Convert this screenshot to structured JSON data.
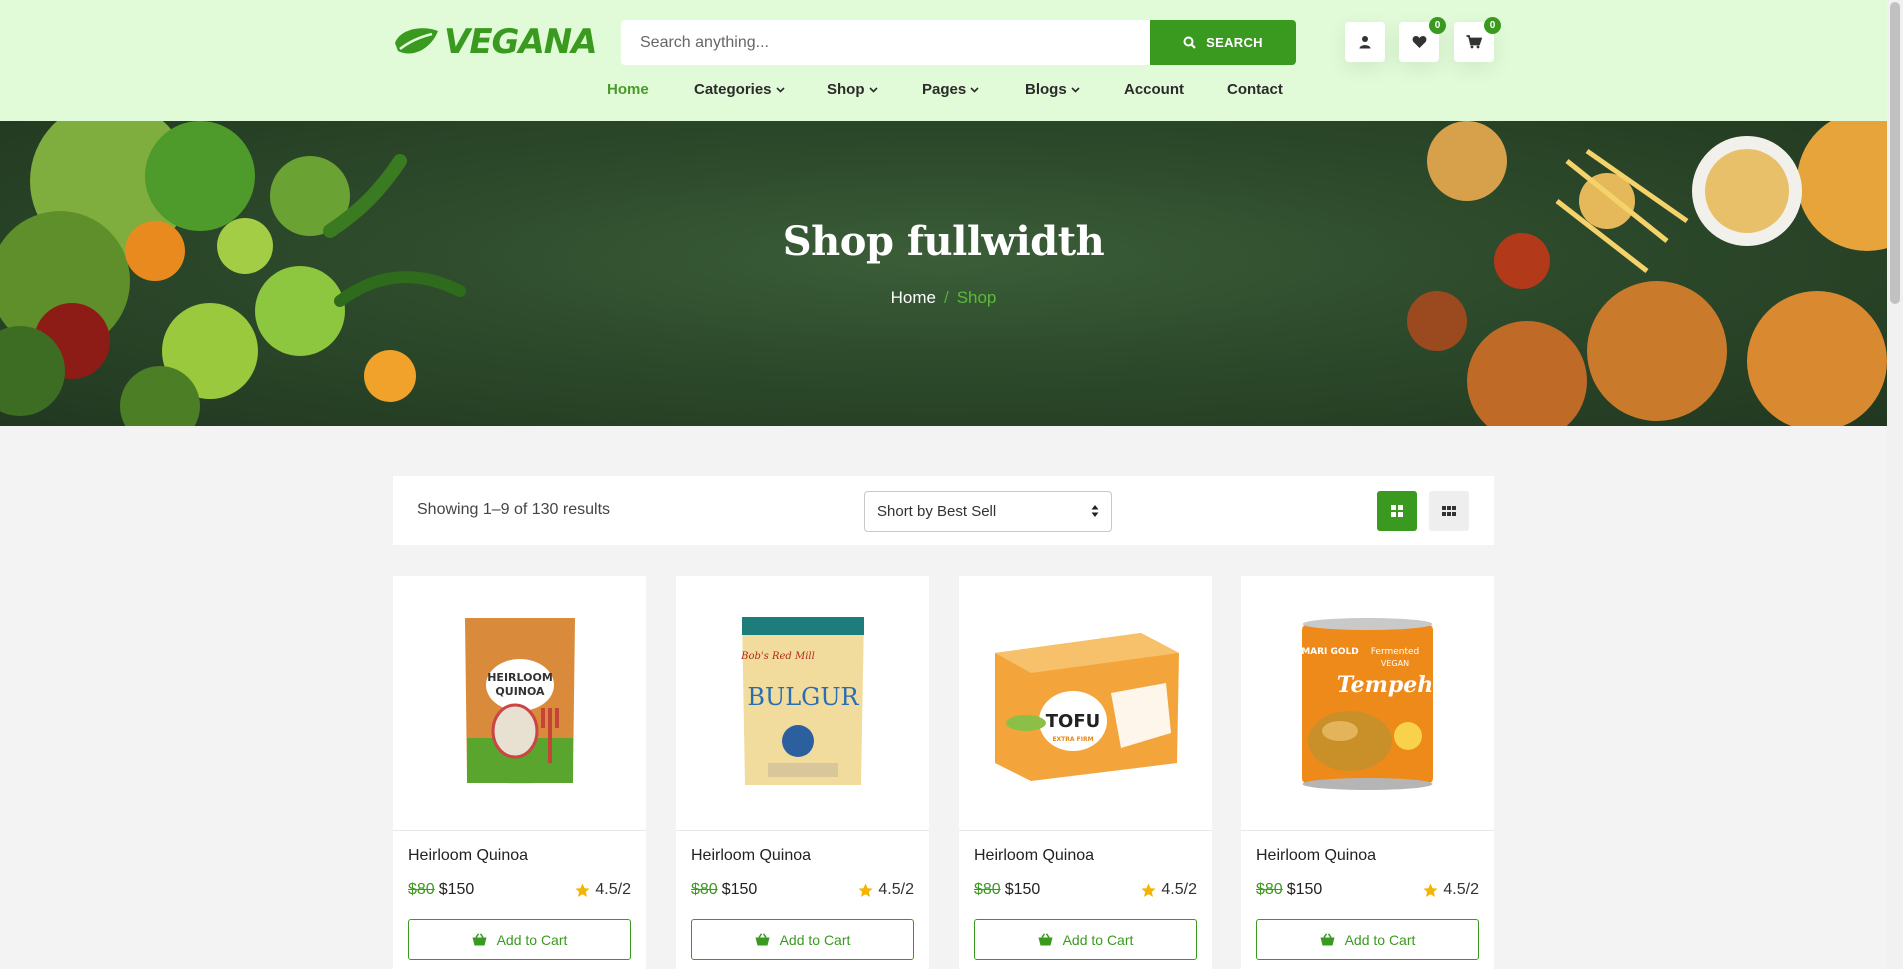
{
  "brand": {
    "name": "VEGANA",
    "accent": "#3a9a1f",
    "header_bg": "#e1fbd8"
  },
  "search": {
    "placeholder": "Search anything...",
    "button_label": "SEARCH"
  },
  "header_icons": {
    "wishlist_count": "0",
    "cart_count": "0"
  },
  "nav": {
    "items": [
      {
        "label": "Home",
        "active": true
      },
      {
        "label": "Categories",
        "dropdown": true
      },
      {
        "label": "Shop",
        "dropdown": true
      },
      {
        "label": "Pages",
        "dropdown": true
      },
      {
        "label": "Blogs",
        "dropdown": true
      },
      {
        "label": "Account"
      },
      {
        "label": "Contact"
      }
    ]
  },
  "banner": {
    "title": "Shop fullwidth",
    "breadcrumb": {
      "home": "Home",
      "separator": "/",
      "current": "Shop"
    }
  },
  "toolbar": {
    "result_count": "Showing 1–9 of 130 results",
    "sort_value": "Short by Best Sell"
  },
  "products": [
    {
      "name": "Heirloom Quinoa",
      "old_price": "$80",
      "price": "$150",
      "rating": "4.5/2",
      "cart_label": "Add to Cart",
      "image": "quinoa-bag"
    },
    {
      "name": "Heirloom Quinoa",
      "old_price": "$80",
      "price": "$150",
      "rating": "4.5/2",
      "cart_label": "Add to Cart",
      "image": "bulgur-bag"
    },
    {
      "name": "Heirloom Quinoa",
      "old_price": "$80",
      "price": "$150",
      "rating": "4.5/2",
      "cart_label": "Add to Cart",
      "image": "tofu-box"
    },
    {
      "name": "Heirloom Quinoa",
      "old_price": "$80",
      "price": "$150",
      "rating": "4.5/2",
      "cart_label": "Add to Cart",
      "image": "tempeh-can"
    }
  ],
  "product_images": {
    "quinoa": {
      "line1": "HEIRLOOM",
      "line2": "QUINOA"
    },
    "bulgur": {
      "brand": "Bob's Red Mill",
      "name": "BULGUR"
    },
    "tofu": {
      "name": "TOFU",
      "sub": "EXTRA FIRM"
    },
    "tempeh": {
      "brand": "MARI GOLD",
      "line1": "Fermented",
      "line2": "VEGAN",
      "name": "Tempeh"
    }
  }
}
